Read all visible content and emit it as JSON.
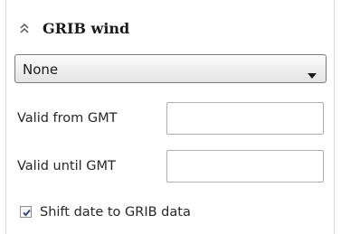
{
  "section": {
    "title": "GRIB wind",
    "collapse_icon": "double-chevron-up-icon"
  },
  "dropdown": {
    "selected": "None",
    "arrow_icon": "triangle-down-icon"
  },
  "fields": {
    "valid_from": {
      "label": "Valid from GMT",
      "value": ""
    },
    "valid_until": {
      "label": "Valid until GMT",
      "value": ""
    }
  },
  "shift_date": {
    "label": "Shift date to GRIB data",
    "checked": true
  },
  "colors": {
    "checkmark": "#2b4a8f",
    "text": "#262626"
  }
}
